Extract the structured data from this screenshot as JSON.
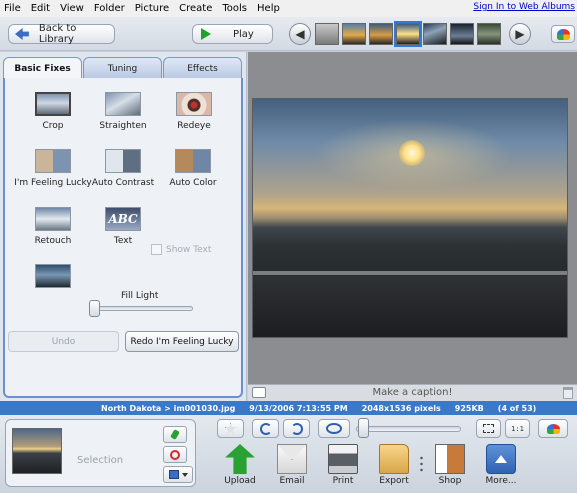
{
  "menu": [
    "File",
    "Edit",
    "View",
    "Folder",
    "Picture",
    "Create",
    "Tools",
    "Help"
  ],
  "signin_link": "Sign In to Web Albums",
  "toolbar": {
    "back_label": "Back to Library",
    "play_label": "Play"
  },
  "tabs": [
    "Basic Fixes",
    "Tuning",
    "Effects"
  ],
  "fixes": {
    "crop": "Crop",
    "straighten": "Straighten",
    "redeye": "Redeye",
    "lucky": "I'm Feeling Lucky",
    "auto_contrast": "Auto Contrast",
    "auto_color": "Auto Color",
    "retouch": "Retouch",
    "text": "Text",
    "text_thumb": "ABC",
    "show_text": "Show Text",
    "fill_light": "Fill Light"
  },
  "fill_light_level": 0,
  "undo_label": "Undo",
  "redo_label": "Redo I'm Feeling Lucky",
  "caption_placeholder": "Make a caption!",
  "status": {
    "path": "North Dakota > im001030.jpg",
    "date": "9/13/2006 7:13:55 PM",
    "dimensions": "2048x1536 pixels",
    "size": "925KB",
    "position": "(4 of 53)"
  },
  "tray_label": "Selection",
  "actions": {
    "upload": "Upload",
    "email": "Email",
    "print": "Print",
    "export": "Export",
    "shop": "Shop",
    "more": "More..."
  },
  "icons": {
    "one_to_one": "1:1"
  },
  "colors": {
    "status_bar": "#3a78c8",
    "tab_border": "#6b8fd0",
    "play_green": "#1fa22a"
  }
}
